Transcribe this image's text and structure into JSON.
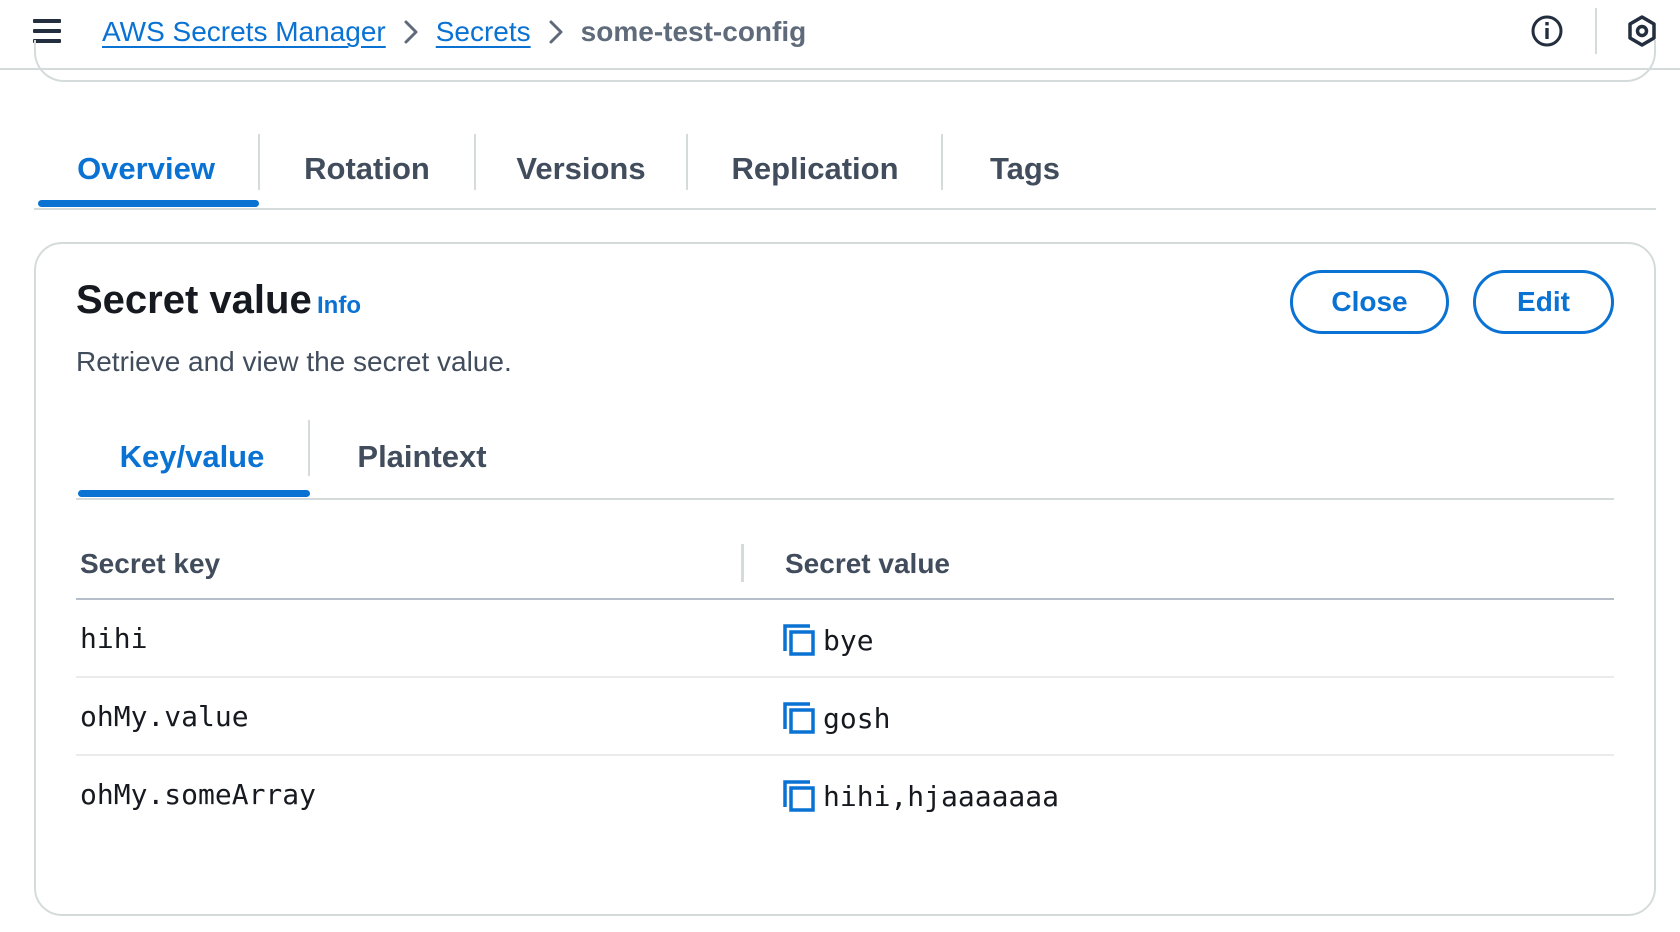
{
  "breadcrumb": {
    "items": [
      "AWS Secrets Manager",
      "Secrets"
    ],
    "current": "some-test-config"
  },
  "main_tabs": [
    {
      "label": "Overview",
      "active": true
    },
    {
      "label": "Rotation",
      "active": false
    },
    {
      "label": "Versions",
      "active": false
    },
    {
      "label": "Replication",
      "active": false
    },
    {
      "label": "Tags",
      "active": false
    }
  ],
  "secret_card": {
    "title": "Secret value",
    "info_link": "Info",
    "description": "Retrieve and view the secret value.",
    "close_label": "Close",
    "edit_label": "Edit",
    "view_tabs": [
      {
        "label": "Key/value",
        "active": true
      },
      {
        "label": "Plaintext",
        "active": false
      }
    ],
    "table": {
      "columns": [
        "Secret key",
        "Secret value"
      ],
      "rows": [
        {
          "key": "hihi",
          "value": "bye"
        },
        {
          "key": "ohMy.value",
          "value": "gosh"
        },
        {
          "key": "ohMy.someArray",
          "value": "hihi,hjaaaaaaa"
        }
      ]
    }
  },
  "icons": {
    "menu": "hamburger-menu-icon",
    "info": "info-circle-icon",
    "settings": "hexagon-settings-icon",
    "copy": "copy-icon",
    "chevron": "chevron-right-icon"
  },
  "colors": {
    "accent": "#0972d3",
    "text": "#16191f",
    "muted": "#414d5c",
    "border": "#d5dbdb"
  }
}
